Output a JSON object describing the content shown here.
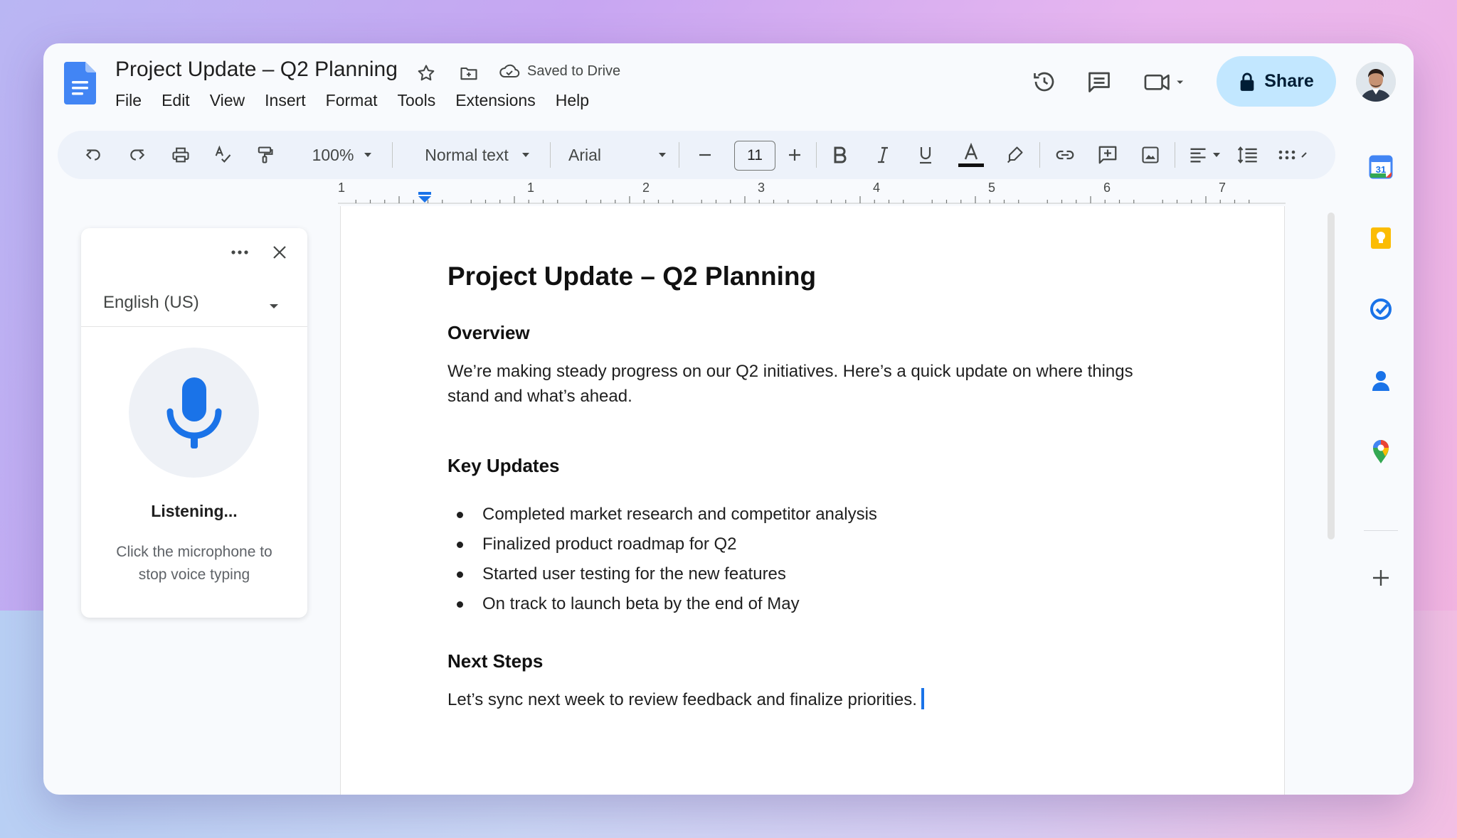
{
  "document": {
    "title": "Project Update – Q2 Planning",
    "save_status": "Saved to Drive"
  },
  "menu": [
    "File",
    "Edit",
    "View",
    "Insert",
    "Format",
    "Tools",
    "Extensions",
    "Help"
  ],
  "header": {
    "share_label": "Share",
    "icons": [
      "version-history-icon",
      "comments-icon",
      "meet-icon"
    ]
  },
  "toolbar": {
    "zoom": "100%",
    "style": "Normal text",
    "font": "Arial",
    "font_size": "11"
  },
  "ruler": {
    "labels": [
      "1",
      "1",
      "2",
      "3",
      "4",
      "5",
      "6",
      "7"
    ]
  },
  "voice_typing": {
    "language": "English (US)",
    "status": "Listening...",
    "hint": "Click the microphone to stop voice typing"
  },
  "content": {
    "heading": "Project Update – Q2 Planning",
    "overview_heading": "Overview",
    "overview_text": "We’re making steady progress on our Q2 initiatives. Here’s a quick update on where things stand and what’s ahead.",
    "key_updates_heading": "Key Updates",
    "key_updates": [
      "Completed market research and competitor analysis",
      "Finalized product roadmap for Q2",
      "Started user testing for the new features",
      "On track to launch beta by the end of May"
    ],
    "next_steps_heading": "Next Steps",
    "next_steps_text": "Let’s sync next week to review feedback and finalize priorities."
  },
  "side_panel": {
    "apps": [
      "calendar-icon",
      "keep-icon",
      "tasks-icon",
      "contacts-icon",
      "maps-icon",
      "add-icon"
    ],
    "calendar_day": "31"
  },
  "colors": {
    "share_bg": "#c2e7ff",
    "accent": "#1a73e8",
    "docs_blue": "#4285f4",
    "toolbar_bg": "#edf2fa"
  }
}
